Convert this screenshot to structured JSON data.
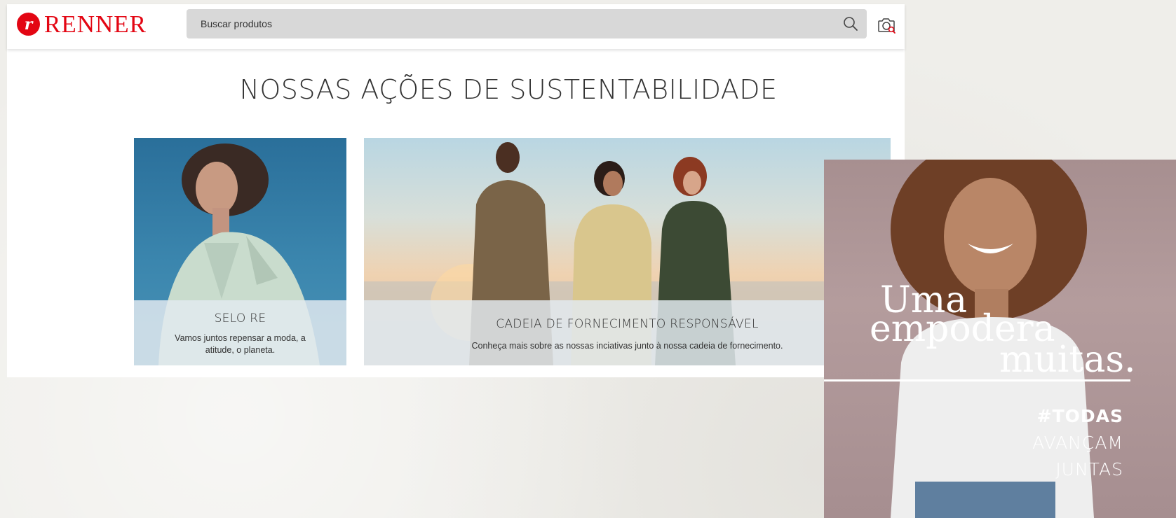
{
  "header": {
    "logo_text": "RENNER",
    "search_placeholder": "Buscar produtos"
  },
  "main": {
    "title": "NOSSAS AÇÕES DE SUSTENTABILIDADE",
    "cards": [
      {
        "title": "SELO RE",
        "description": "Vamos juntos repensar a moda, a atitude, o planeta."
      },
      {
        "title": "CADEIA DE FORNECIMENTO RESPONSÁVEL",
        "description": "Conheça mais sobre as nossas inciativas junto à nossa cadeia de fornecimento."
      }
    ]
  },
  "campaign": {
    "headline": [
      "Uma",
      "empodera",
      "muitas."
    ],
    "tags": [
      "#TODAS",
      "AVANÇAM",
      "JUNTAS"
    ]
  },
  "colors": {
    "brand": "#e30613",
    "search_bg": "#d8d8d8",
    "overlay_bg": "#e2eaef"
  },
  "icons": [
    "search-icon",
    "camera-search-icon"
  ]
}
